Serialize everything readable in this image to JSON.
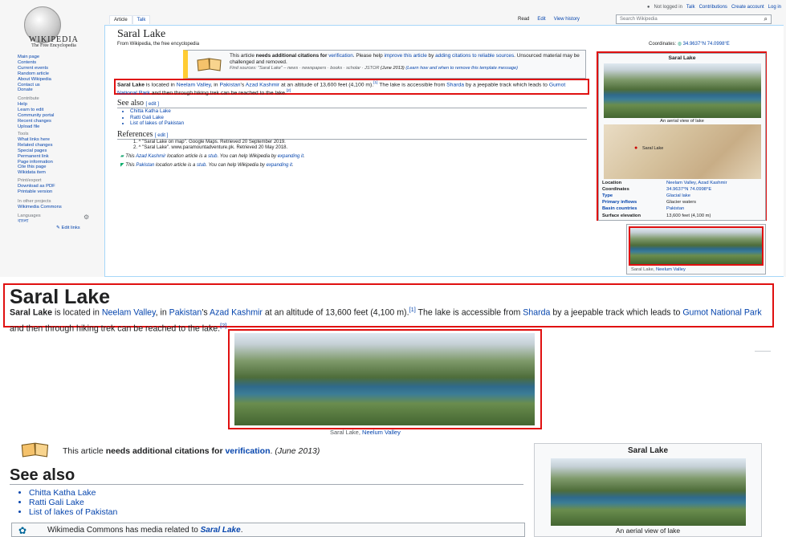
{
  "user_links": [
    "Not logged in",
    "Talk",
    "Contributions",
    "Create account",
    "Log in"
  ],
  "logo": {
    "title": "WIKIPEDIA",
    "tagline": "The Free Encyclopedia"
  },
  "nav": {
    "main": [
      "Main page",
      "Contents",
      "Current events",
      "Random article",
      "About Wikipedia",
      "Contact us",
      "Donate"
    ],
    "contribute_h": "Contribute",
    "contribute": [
      "Help",
      "Learn to edit",
      "Community portal",
      "Recent changes",
      "Upload file"
    ],
    "tools_h": "Tools",
    "tools": [
      "What links here",
      "Related changes",
      "Special pages",
      "Permanent link",
      "Page information",
      "Cite this page",
      "Wikidata item"
    ],
    "print_h": "Print/export",
    "print": [
      "Download as PDF",
      "Printable version"
    ],
    "other_h": "In other projects",
    "other": [
      "Wikimedia Commons"
    ],
    "lang_h": "Languages",
    "lang": [
      "বাংলা"
    ],
    "edit_links": "Edit links"
  },
  "tabs": {
    "article": "Article",
    "talk": "Talk",
    "read": "Read",
    "edit": "Edit",
    "history": "View history"
  },
  "search": {
    "placeholder": "Search Wikipedia"
  },
  "article": {
    "title": "Saral Lake",
    "from": "From Wikipedia, the free encyclopedia",
    "coords_label": "Coordinates:",
    "coords": "34.9637°N 74.0998°E",
    "ambox": {
      "p1": "This article ",
      "p2": "needs additional citations for ",
      "p3": "verification",
      "p4": ". Please help ",
      "p5": "improve this article",
      "p6": " by ",
      "p7": "adding citations to reliable sources",
      "p8": ". Unsourced material may be challenged and removed.",
      "find": "Find sources: \"Saral Lake\" – news · newspapers · books · scholar · JSTOR",
      "date": " (June 2013)",
      "learn": " (Learn how and when to remove this template message)"
    },
    "lead": {
      "b": "Saral Lake",
      "t1": " is located in ",
      "l1": "Neelam Valley",
      "t2": ", in ",
      "l2": "Pakistan",
      "t3": "'s ",
      "l3": "Azad Kashmir",
      "t4": " at an altitude of 13,600 feet (4,100 m).",
      "s1": "[1]",
      "t5": " The lake is accessible from ",
      "l4": "Sharda",
      "t6": " by a jeepable track which leads to ",
      "l5": "Gumot National Park",
      "t7": " and then through hiking trek can be reached to the lake.",
      "s2": "[2]"
    },
    "see_also": {
      "h": "See also",
      "edit": "[ edit ]",
      "items": [
        "Chitta Katha Lake",
        "Ratti Gali Lake",
        "List of lakes of Pakistan"
      ]
    },
    "references": {
      "h": "References",
      "edit": "[ edit ]",
      "r1": "1. ^ \"Saral Lake on map\". Google Maps. Retrieved 20 September 2019.",
      "r2": "2. ^ \"Saral Lake\". www.paramountadventure.pk. Retrieved 20 May 2018."
    },
    "stub1": {
      "t1": "This ",
      "l": "Azad Kashmir",
      "t2": " location article is a ",
      "s": "stub",
      "t3": ". You can help Wikipedia by ",
      "e": "expanding it",
      "t4": "."
    },
    "stub2": {
      "t1": "This ",
      "l": "Pakistan",
      "t2": " location article is a ",
      "s": "stub",
      "t3": ". You can help Wikipedia by ",
      "e": "expanding it",
      "t4": "."
    }
  },
  "infobox": {
    "title": "Saral Lake",
    "caption": "An aerial view of lake",
    "map_label": "Saral Lake",
    "rows": [
      [
        "Location",
        "Neelam Valley, Azad Kashmir"
      ],
      [
        "Coordinates",
        "34.9637°N 74.0998°E"
      ],
      [
        "Type",
        "Glacial lake"
      ],
      [
        "Primary inflows",
        "Glacier waters"
      ],
      [
        "Basin countries",
        "Pakistan"
      ],
      [
        "Surface elevation",
        "13,600 feet (4,100 m)"
      ]
    ]
  },
  "thumb": {
    "caption_t": "Saral Lake, ",
    "caption_l": "Neelum Valley"
  },
  "zoom": {
    "title": "Saral Lake",
    "notice_t1": "This article ",
    "notice_b": "needs additional citations for ",
    "notice_l": "verification",
    "notice_t2": ". ",
    "notice_d": "(June 2013)",
    "see_h": "See also",
    "see_items": [
      "Chitta Katha Lake",
      "Ratti Gali Lake",
      "List of lakes of Pakistan"
    ],
    "commons_t": "Wikimedia Commons has media related to ",
    "commons_l": "Saral Lake",
    "commons_e": ".",
    "ibox_title": "Saral Lake",
    "ibox_caption": "An aerial view of lake"
  }
}
